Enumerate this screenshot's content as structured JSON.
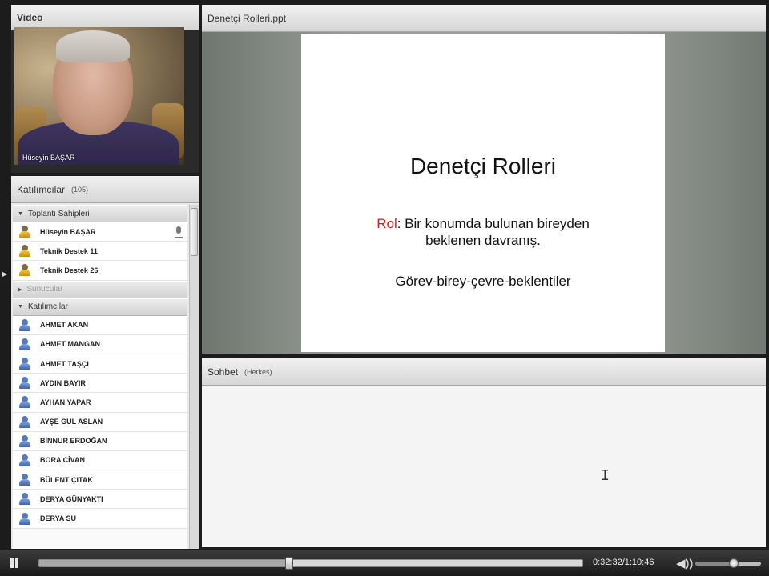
{
  "video": {
    "title": "Video",
    "speaker_name": "Hüseyin BAŞAR"
  },
  "participants": {
    "title": "Katılımcılar",
    "count": "(105)",
    "groups": [
      {
        "label": "Toplantı Sahipleri",
        "expanded": true,
        "members": [
          "Hüseyin BAŞAR",
          "Teknik Destek 11",
          "Teknik Destek 26"
        ]
      },
      {
        "label": "Sunucular",
        "expanded": false,
        "members": []
      },
      {
        "label": "Katılımcılar",
        "expanded": true,
        "members": [
          "AHMET AKAN",
          "AHMET MANGAN",
          "AHMET TAŞÇI",
          "AYDIN BAYIR",
          "AYHAN YAPAR",
          "AYŞE GÜL ASLAN",
          "BİNNUR ERDOĞAN",
          "BORA CİVAN",
          "BÜLENT ÇITAK",
          "DERYA GÜNYAKTI",
          "DERYA SU"
        ]
      }
    ]
  },
  "presentation": {
    "title": "Denetçi  Rolleri.ppt",
    "slide": {
      "heading": "Denetçi  Rolleri",
      "rol_label": "Rol",
      "line1_rest": ": Bir konumda bulunan bireyden",
      "line2": "beklenen davranış.",
      "line3": "Görev-birey-çevre-beklentiler"
    }
  },
  "chat": {
    "title": "Sohbet",
    "audience": "(Herkes)"
  },
  "player": {
    "time_readout": "0:32:32/1:10:46",
    "progress": 0.46,
    "volume": 0.58
  },
  "icons": {
    "host": "host-user-icon",
    "participant": "participant-user-icon",
    "mic": "microphone-icon",
    "pause": "pause-icon",
    "volume": "volume-icon",
    "cursor": "text-cursor-icon"
  },
  "colors": {
    "slide_accent": "#d01e1e",
    "host_icon": "#f2c33a",
    "participant_icon": "#5878b8"
  }
}
